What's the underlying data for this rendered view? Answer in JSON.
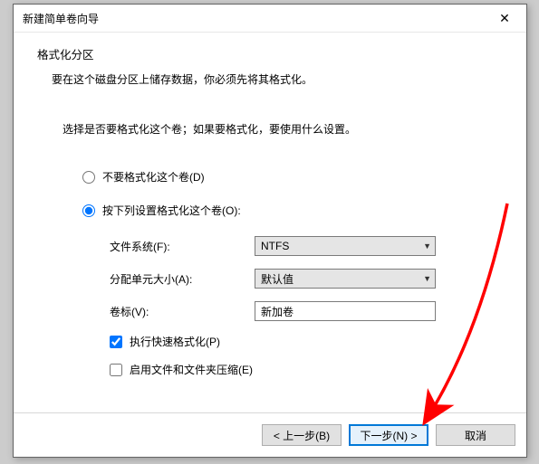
{
  "window": {
    "title": "新建简单卷向导"
  },
  "header": {
    "title": "格式化分区",
    "subtitle": "要在这个磁盘分区上储存数据，你必须先将其格式化。"
  },
  "instruction": "选择是否要格式化这个卷；如果要格式化，要使用什么设置。",
  "options": {
    "no_format": "不要格式化这个卷(D)",
    "format_with": "按下列设置格式化这个卷(O):"
  },
  "fields": {
    "fs_label": "文件系统(F):",
    "fs_value": "NTFS",
    "alloc_label": "分配单元大小(A):",
    "alloc_value": "默认值",
    "vol_label": "卷标(V):",
    "vol_value": "新加卷"
  },
  "checks": {
    "quick": "执行快速格式化(P)",
    "compress": "启用文件和文件夹压缩(E)"
  },
  "buttons": {
    "back": "< 上一步(B)",
    "next": "下一步(N) >",
    "cancel": "取消"
  }
}
